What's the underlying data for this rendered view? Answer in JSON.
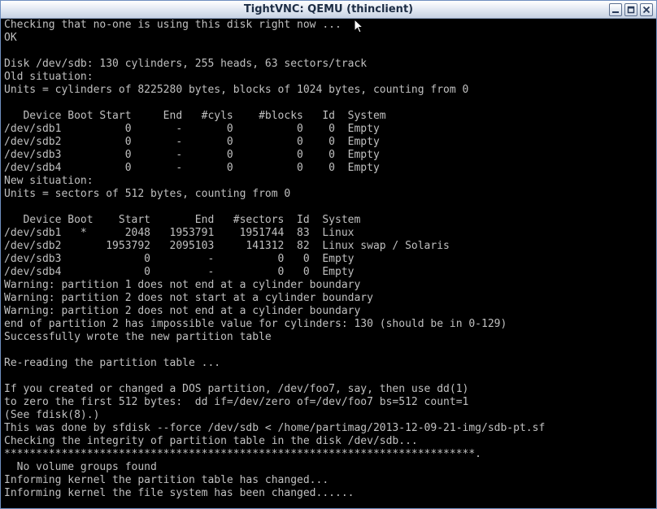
{
  "window": {
    "title": "TightVNC: QEMU (thinclient)"
  },
  "icons": {
    "minimize": "minimize-icon",
    "maximize": "maximize-icon",
    "close": "close-icon",
    "cursor": "mouse-pointer-icon"
  },
  "colors": {
    "terminal_background": "#000000",
    "terminal_text": "#c0c0c0",
    "titlebar": "#dfe6f1"
  },
  "terminal": {
    "lines": [
      "Checking that no-one is using this disk right now ...",
      "OK",
      "",
      "Disk /dev/sdb: 130 cylinders, 255 heads, 63 sectors/track",
      "Old situation:",
      "Units = cylinders of 8225280 bytes, blocks of 1024 bytes, counting from 0",
      "",
      "   Device Boot Start     End   #cyls    #blocks   Id  System",
      "/dev/sdb1          0       -       0          0    0  Empty",
      "/dev/sdb2          0       -       0          0    0  Empty",
      "/dev/sdb3          0       -       0          0    0  Empty",
      "/dev/sdb4          0       -       0          0    0  Empty",
      "New situation:",
      "Units = sectors of 512 bytes, counting from 0",
      "",
      "   Device Boot    Start       End   #sectors  Id  System",
      "/dev/sdb1   *      2048   1953791    1951744  83  Linux",
      "/dev/sdb2       1953792   2095103     141312  82  Linux swap / Solaris",
      "/dev/sdb3             0         -          0   0  Empty",
      "/dev/sdb4             0         -          0   0  Empty",
      "Warning: partition 1 does not end at a cylinder boundary",
      "Warning: partition 2 does not start at a cylinder boundary",
      "Warning: partition 2 does not end at a cylinder boundary",
      "end of partition 2 has impossible value for cylinders: 130 (should be in 0-129)",
      "Successfully wrote the new partition table",
      "",
      "Re-reading the partition table ...",
      "",
      "If you created or changed a DOS partition, /dev/foo7, say, then use dd(1)",
      "to zero the first 512 bytes:  dd if=/dev/zero of=/dev/foo7 bs=512 count=1",
      "(See fdisk(8).)",
      "This was done by sfdisk --force /dev/sdb < /home/partimag/2013-12-09-21-img/sdb-pt.sf",
      "Checking the integrity of partition table in the disk /dev/sdb...",
      "**************************************************************************.",
      "  No volume groups found",
      "Informing kernel the partition table has changed...",
      "Informing kernel the file system has been changed......"
    ]
  }
}
